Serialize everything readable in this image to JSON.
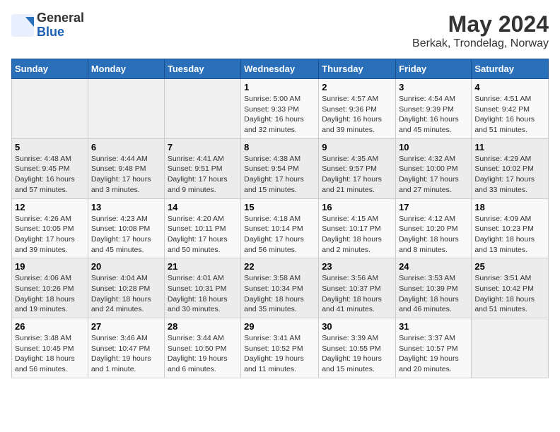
{
  "header": {
    "logo": {
      "general": "General",
      "blue": "Blue"
    },
    "title": "May 2024",
    "subtitle": "Berkak, Trondelag, Norway"
  },
  "columns": [
    "Sunday",
    "Monday",
    "Tuesday",
    "Wednesday",
    "Thursday",
    "Friday",
    "Saturday"
  ],
  "weeks": [
    [
      {
        "day": "",
        "sunrise": "",
        "sunset": "",
        "daylight": ""
      },
      {
        "day": "",
        "sunrise": "",
        "sunset": "",
        "daylight": ""
      },
      {
        "day": "",
        "sunrise": "",
        "sunset": "",
        "daylight": ""
      },
      {
        "day": "1",
        "sunrise": "Sunrise: 5:00 AM",
        "sunset": "Sunset: 9:33 PM",
        "daylight": "Daylight: 16 hours and 32 minutes."
      },
      {
        "day": "2",
        "sunrise": "Sunrise: 4:57 AM",
        "sunset": "Sunset: 9:36 PM",
        "daylight": "Daylight: 16 hours and 39 minutes."
      },
      {
        "day": "3",
        "sunrise": "Sunrise: 4:54 AM",
        "sunset": "Sunset: 9:39 PM",
        "daylight": "Daylight: 16 hours and 45 minutes."
      },
      {
        "day": "4",
        "sunrise": "Sunrise: 4:51 AM",
        "sunset": "Sunset: 9:42 PM",
        "daylight": "Daylight: 16 hours and 51 minutes."
      }
    ],
    [
      {
        "day": "5",
        "sunrise": "Sunrise: 4:48 AM",
        "sunset": "Sunset: 9:45 PM",
        "daylight": "Daylight: 16 hours and 57 minutes."
      },
      {
        "day": "6",
        "sunrise": "Sunrise: 4:44 AM",
        "sunset": "Sunset: 9:48 PM",
        "daylight": "Daylight: 17 hours and 3 minutes."
      },
      {
        "day": "7",
        "sunrise": "Sunrise: 4:41 AM",
        "sunset": "Sunset: 9:51 PM",
        "daylight": "Daylight: 17 hours and 9 minutes."
      },
      {
        "day": "8",
        "sunrise": "Sunrise: 4:38 AM",
        "sunset": "Sunset: 9:54 PM",
        "daylight": "Daylight: 17 hours and 15 minutes."
      },
      {
        "day": "9",
        "sunrise": "Sunrise: 4:35 AM",
        "sunset": "Sunset: 9:57 PM",
        "daylight": "Daylight: 17 hours and 21 minutes."
      },
      {
        "day": "10",
        "sunrise": "Sunrise: 4:32 AM",
        "sunset": "Sunset: 10:00 PM",
        "daylight": "Daylight: 17 hours and 27 minutes."
      },
      {
        "day": "11",
        "sunrise": "Sunrise: 4:29 AM",
        "sunset": "Sunset: 10:02 PM",
        "daylight": "Daylight: 17 hours and 33 minutes."
      }
    ],
    [
      {
        "day": "12",
        "sunrise": "Sunrise: 4:26 AM",
        "sunset": "Sunset: 10:05 PM",
        "daylight": "Daylight: 17 hours and 39 minutes."
      },
      {
        "day": "13",
        "sunrise": "Sunrise: 4:23 AM",
        "sunset": "Sunset: 10:08 PM",
        "daylight": "Daylight: 17 hours and 45 minutes."
      },
      {
        "day": "14",
        "sunrise": "Sunrise: 4:20 AM",
        "sunset": "Sunset: 10:11 PM",
        "daylight": "Daylight: 17 hours and 50 minutes."
      },
      {
        "day": "15",
        "sunrise": "Sunrise: 4:18 AM",
        "sunset": "Sunset: 10:14 PM",
        "daylight": "Daylight: 17 hours and 56 minutes."
      },
      {
        "day": "16",
        "sunrise": "Sunrise: 4:15 AM",
        "sunset": "Sunset: 10:17 PM",
        "daylight": "Daylight: 18 hours and 2 minutes."
      },
      {
        "day": "17",
        "sunrise": "Sunrise: 4:12 AM",
        "sunset": "Sunset: 10:20 PM",
        "daylight": "Daylight: 18 hours and 8 minutes."
      },
      {
        "day": "18",
        "sunrise": "Sunrise: 4:09 AM",
        "sunset": "Sunset: 10:23 PM",
        "daylight": "Daylight: 18 hours and 13 minutes."
      }
    ],
    [
      {
        "day": "19",
        "sunrise": "Sunrise: 4:06 AM",
        "sunset": "Sunset: 10:26 PM",
        "daylight": "Daylight: 18 hours and 19 minutes."
      },
      {
        "day": "20",
        "sunrise": "Sunrise: 4:04 AM",
        "sunset": "Sunset: 10:28 PM",
        "daylight": "Daylight: 18 hours and 24 minutes."
      },
      {
        "day": "21",
        "sunrise": "Sunrise: 4:01 AM",
        "sunset": "Sunset: 10:31 PM",
        "daylight": "Daylight: 18 hours and 30 minutes."
      },
      {
        "day": "22",
        "sunrise": "Sunrise: 3:58 AM",
        "sunset": "Sunset: 10:34 PM",
        "daylight": "Daylight: 18 hours and 35 minutes."
      },
      {
        "day": "23",
        "sunrise": "Sunrise: 3:56 AM",
        "sunset": "Sunset: 10:37 PM",
        "daylight": "Daylight: 18 hours and 41 minutes."
      },
      {
        "day": "24",
        "sunrise": "Sunrise: 3:53 AM",
        "sunset": "Sunset: 10:39 PM",
        "daylight": "Daylight: 18 hours and 46 minutes."
      },
      {
        "day": "25",
        "sunrise": "Sunrise: 3:51 AM",
        "sunset": "Sunset: 10:42 PM",
        "daylight": "Daylight: 18 hours and 51 minutes."
      }
    ],
    [
      {
        "day": "26",
        "sunrise": "Sunrise: 3:48 AM",
        "sunset": "Sunset: 10:45 PM",
        "daylight": "Daylight: 18 hours and 56 minutes."
      },
      {
        "day": "27",
        "sunrise": "Sunrise: 3:46 AM",
        "sunset": "Sunset: 10:47 PM",
        "daylight": "Daylight: 19 hours and 1 minute."
      },
      {
        "day": "28",
        "sunrise": "Sunrise: 3:44 AM",
        "sunset": "Sunset: 10:50 PM",
        "daylight": "Daylight: 19 hours and 6 minutes."
      },
      {
        "day": "29",
        "sunrise": "Sunrise: 3:41 AM",
        "sunset": "Sunset: 10:52 PM",
        "daylight": "Daylight: 19 hours and 11 minutes."
      },
      {
        "day": "30",
        "sunrise": "Sunrise: 3:39 AM",
        "sunset": "Sunset: 10:55 PM",
        "daylight": "Daylight: 19 hours and 15 minutes."
      },
      {
        "day": "31",
        "sunrise": "Sunrise: 3:37 AM",
        "sunset": "Sunset: 10:57 PM",
        "daylight": "Daylight: 19 hours and 20 minutes."
      },
      {
        "day": "",
        "sunrise": "",
        "sunset": "",
        "daylight": ""
      }
    ]
  ]
}
